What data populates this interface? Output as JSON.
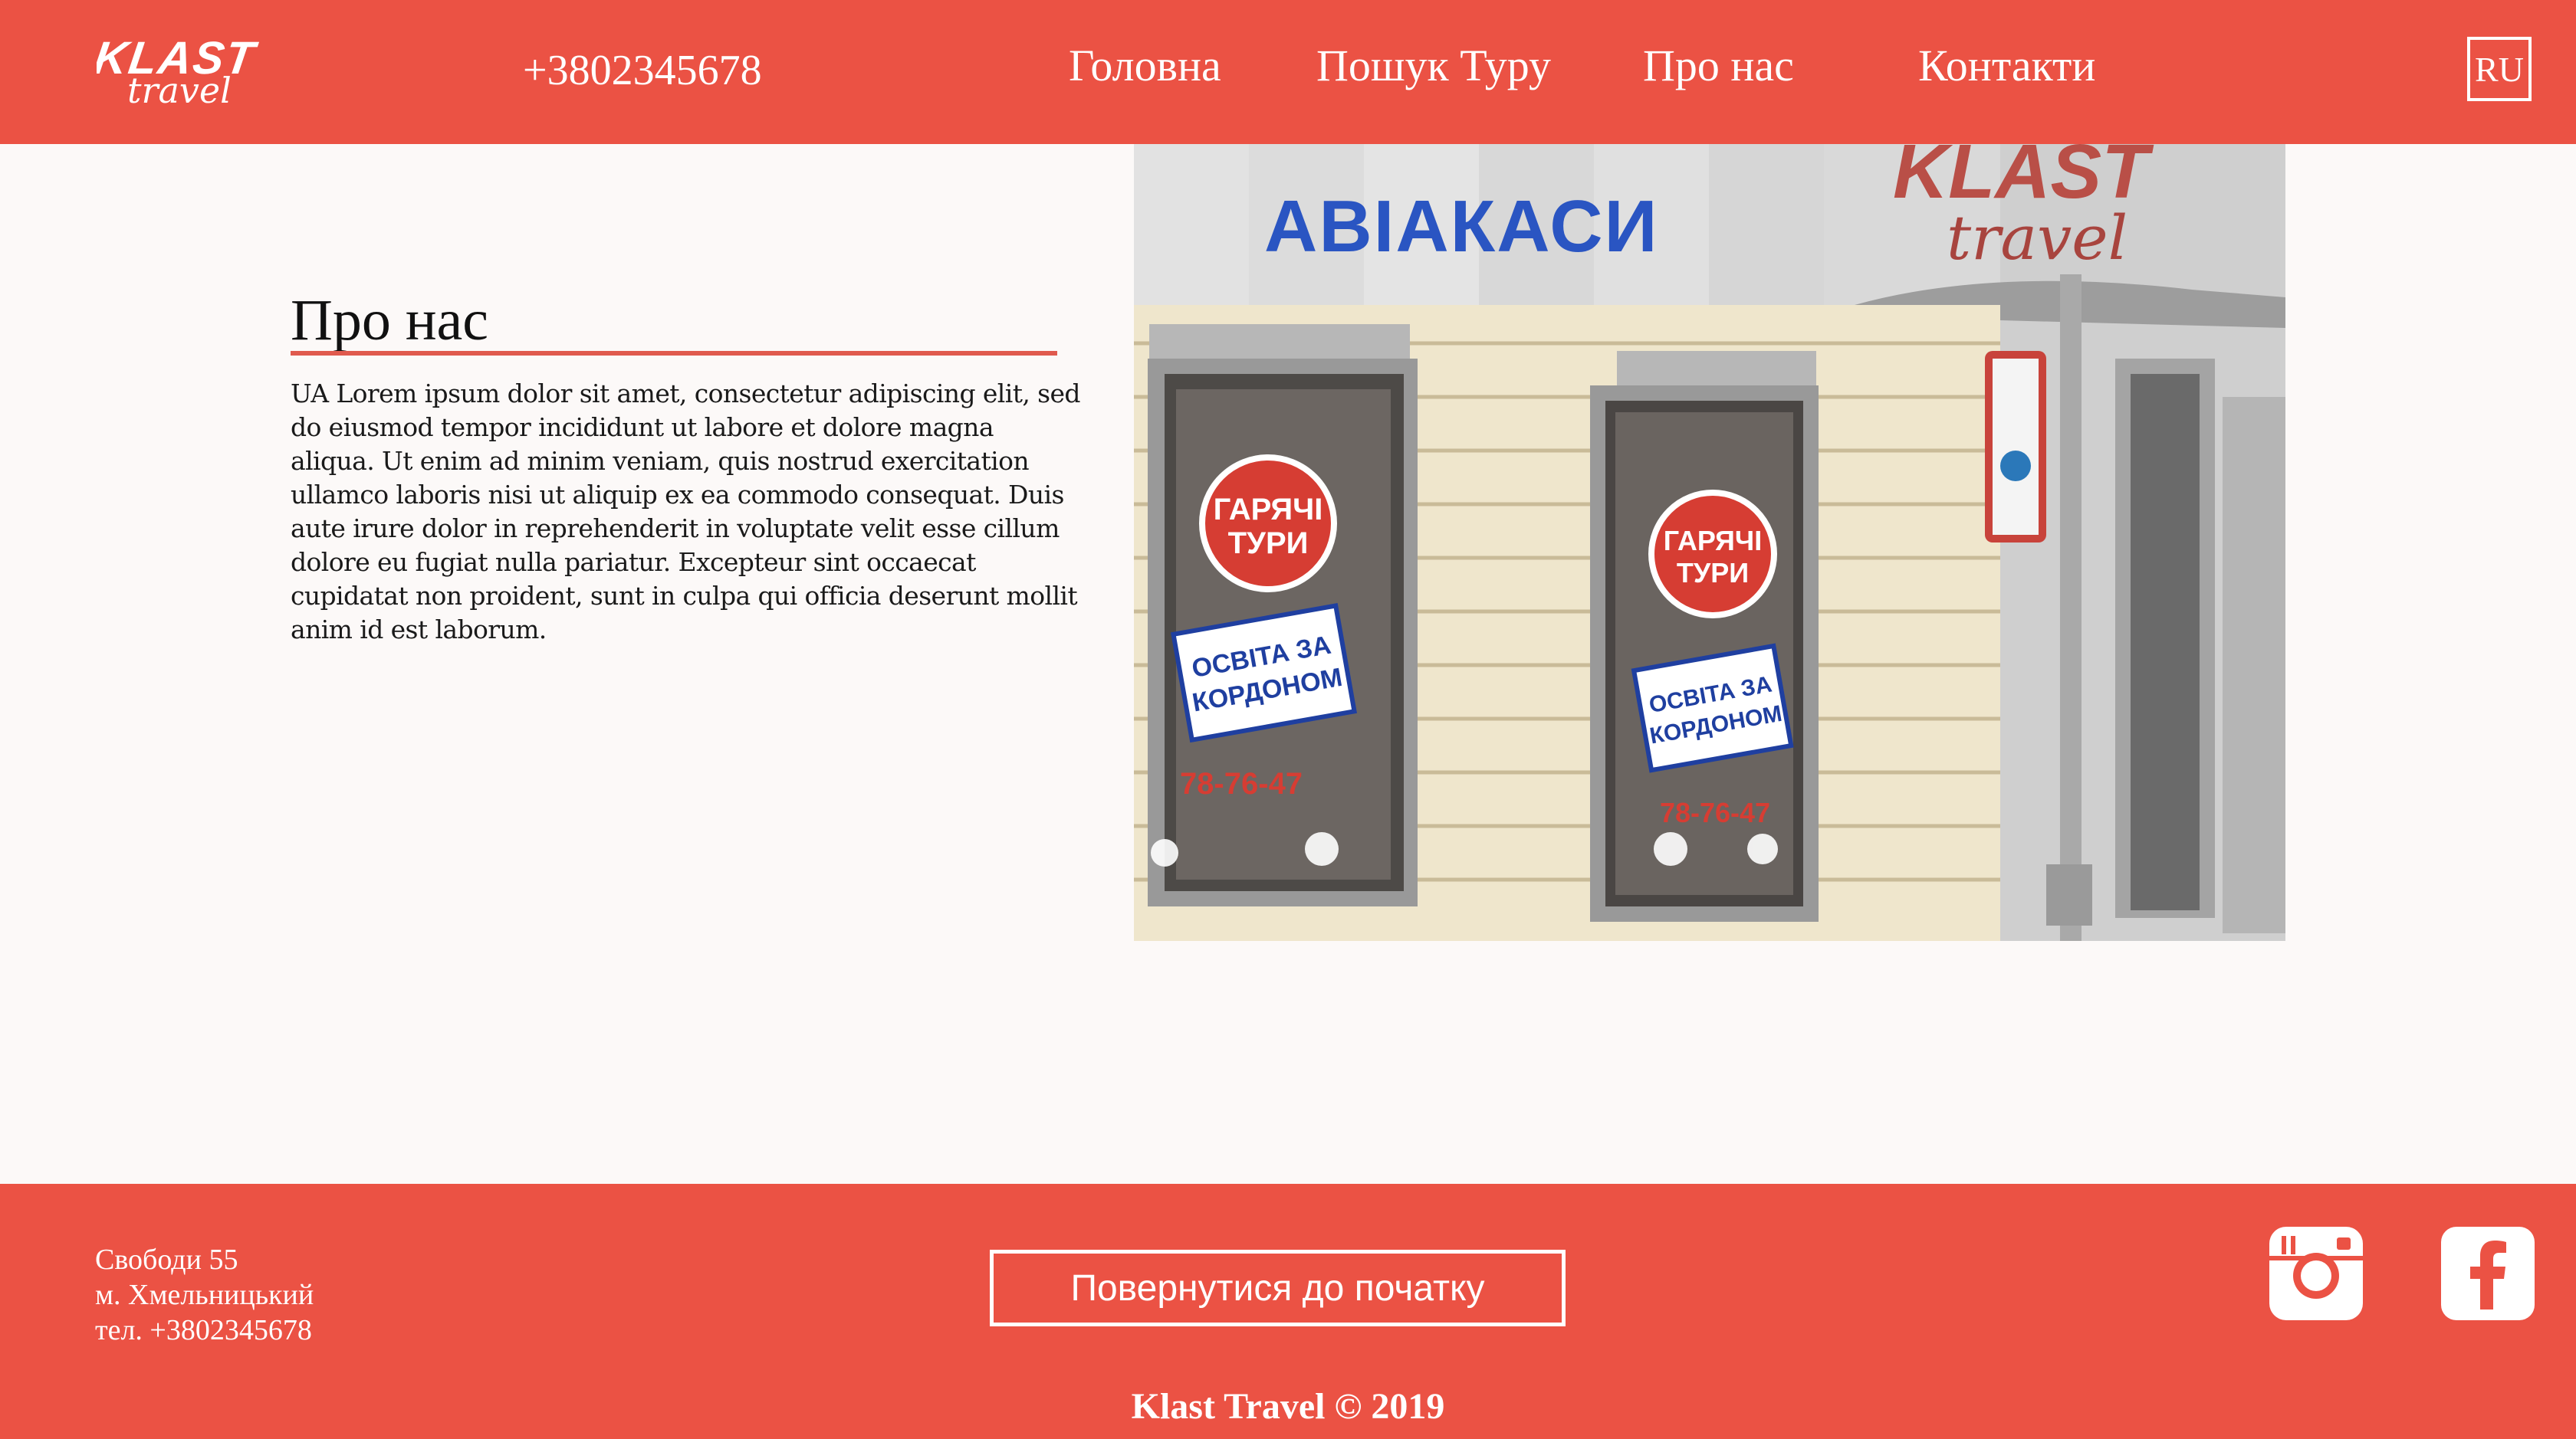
{
  "header": {
    "logo_text_top": "KLAST",
    "logo_text_bottom": "travel",
    "phone": "+3802345678",
    "nav": [
      "Головна",
      "Пошук Туру",
      "Про нас",
      "Контакти"
    ],
    "lang": "RU"
  },
  "main": {
    "title": "Про нас",
    "text": "UA Lorem ipsum dolor sit amet, consectetur adipiscing elit, sed do eiusmod tempor incididunt ut labore et dolore magna aliqua. Ut enim ad minim veniam, quis nostrud exercitation ullamco laboris nisi ut aliquip ex ea commodo consequat. Duis aute irure dolor in reprehenderit in voluptate velit esse cillum dolore eu fugiat nulla pariatur. Excepteur sint occaecat cupidatat non proident, sunt in culpa qui officia deserunt mollit anim id est laborum.",
    "photo": {
      "sign_left": "АВІАКАСИ",
      "sign_right_top": "KLAST",
      "sign_right_bottom": "travel",
      "sticker_hot": [
        "ГАРЯЧІ",
        "ТУРИ"
      ],
      "sticker_edu": [
        "ОСВІТА ЗА",
        "КОРДОНОМ"
      ],
      "sticker_phone": "78-76-47"
    }
  },
  "footer": {
    "address": [
      "Свободи 55",
      "м. Хмельницький",
      "тел. +3802345678"
    ],
    "back_button": "Повернутися до початку",
    "copyright": "Klast Travel © 2019"
  },
  "icons": [
    "instagram-icon",
    "facebook-icon"
  ],
  "colors": {
    "brand": "#eb5244",
    "background": "#fcf9f8"
  }
}
